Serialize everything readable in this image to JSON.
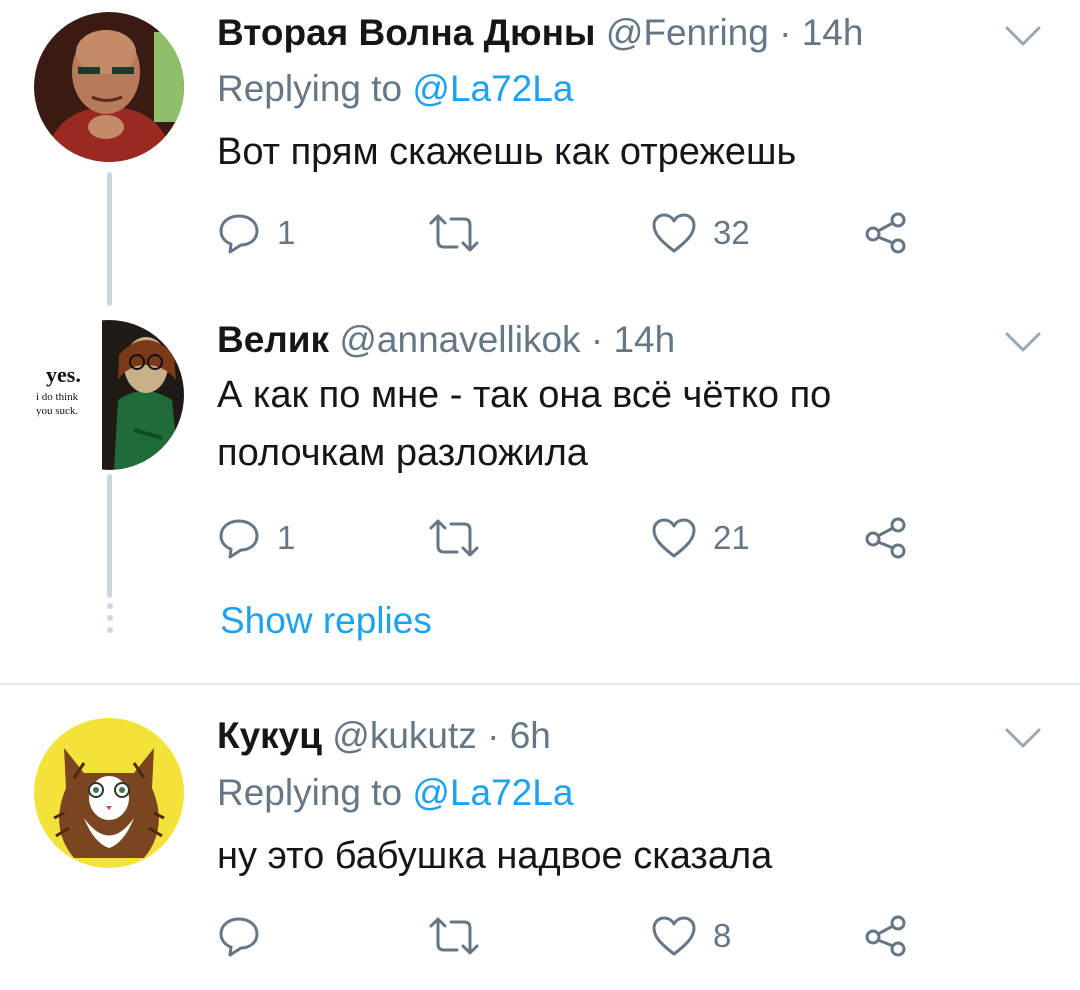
{
  "tweets": [
    {
      "name": "Вторая Волна Дюны",
      "handle": "@Fenring",
      "separator": "·",
      "time": "14h",
      "replying_label": "Replying to",
      "replying_to": "@La72La",
      "text": "Вот прям скажешь как отрежешь",
      "reply_count": "1",
      "retweet_count": "",
      "like_count": "32"
    },
    {
      "name": "Велик",
      "handle": "@annavellikok",
      "separator": "·",
      "time": "14h",
      "text_line1": "А как по мне - так она всё чётко по",
      "text_line2": "полочкам разложила",
      "reply_count": "1",
      "retweet_count": "",
      "like_count": "21",
      "avatar_text": [
        "yes.",
        "i do think",
        "you suck."
      ]
    },
    {
      "name": "Кукуц",
      "handle": "@kukutz",
      "separator": "·",
      "time": "6h",
      "replying_label": "Replying to",
      "replying_to": "@La72La",
      "text": "ну это бабушка надвое сказала",
      "reply_count": "",
      "retweet_count": "",
      "like_count": "8"
    }
  ],
  "show_replies": "Show replies",
  "colors": {
    "accent": "#1da1f2",
    "secondary_text": "#657786",
    "primary_text": "#14171a",
    "thread_line": "#ccd6dd",
    "icon": "#657786"
  },
  "icons": [
    "chevron-down-icon",
    "reply-icon",
    "retweet-icon",
    "like-icon",
    "share-icon"
  ]
}
